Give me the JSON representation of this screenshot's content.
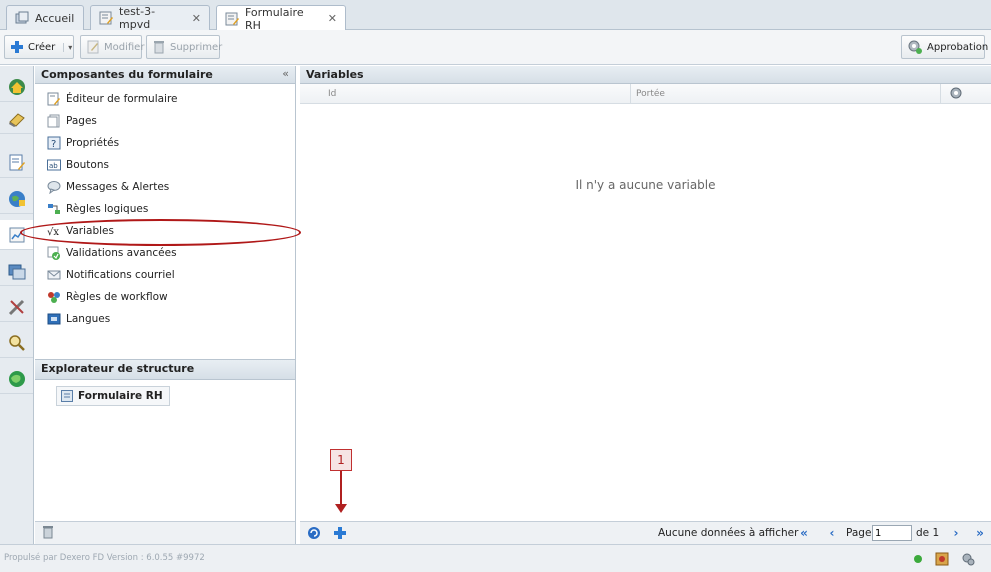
{
  "tabs": [
    {
      "label": "Accueil",
      "closable": false
    },
    {
      "label": "test-3-mpvd",
      "closable": true
    },
    {
      "label": "Formulaire RH",
      "closable": true,
      "active": true
    }
  ],
  "toolbar": {
    "create_label": "Créer",
    "edit_label": "Modifier",
    "delete_label": "Supprimer",
    "approval_label": "Approbation"
  },
  "left_panel": {
    "title": "Composantes du formulaire",
    "collapse_glyph": "«",
    "items": [
      {
        "label": "Éditeur de formulaire",
        "icon": "form-editor-icon"
      },
      {
        "label": "Pages",
        "icon": "pages-icon"
      },
      {
        "label": "Propriétés",
        "icon": "properties-icon"
      },
      {
        "label": "Boutons",
        "icon": "buttons-icon"
      },
      {
        "label": "Messages & Alertes",
        "icon": "messages-icon"
      },
      {
        "label": "Règles logiques",
        "icon": "logic-rules-icon"
      },
      {
        "label": "Variables",
        "icon": "variables-icon",
        "selected": true
      },
      {
        "label": "Validations avancées",
        "icon": "validations-icon"
      },
      {
        "label": "Notifications courriel",
        "icon": "email-notifications-icon"
      },
      {
        "label": "Règles de workflow",
        "icon": "workflow-rules-icon"
      },
      {
        "label": "Langues",
        "icon": "languages-icon"
      }
    ]
  },
  "explorer": {
    "title": "Explorateur de structure",
    "node_label": "Formulaire RH"
  },
  "main": {
    "title": "Variables",
    "columns": [
      "Id",
      "Portée"
    ],
    "empty_message": "Il n'y a aucune variable",
    "pager": {
      "no_data": "Aucune données à afficher",
      "page_label": "Page",
      "page_value": "1",
      "of_label": "de 1"
    }
  },
  "annotation": {
    "label": "1"
  },
  "status": {
    "text": "Propulsé par Dexero FD Version : 6.0.55 #9972"
  },
  "colors": {
    "accent": "#2a6cc4",
    "annotation": "#b02020"
  }
}
